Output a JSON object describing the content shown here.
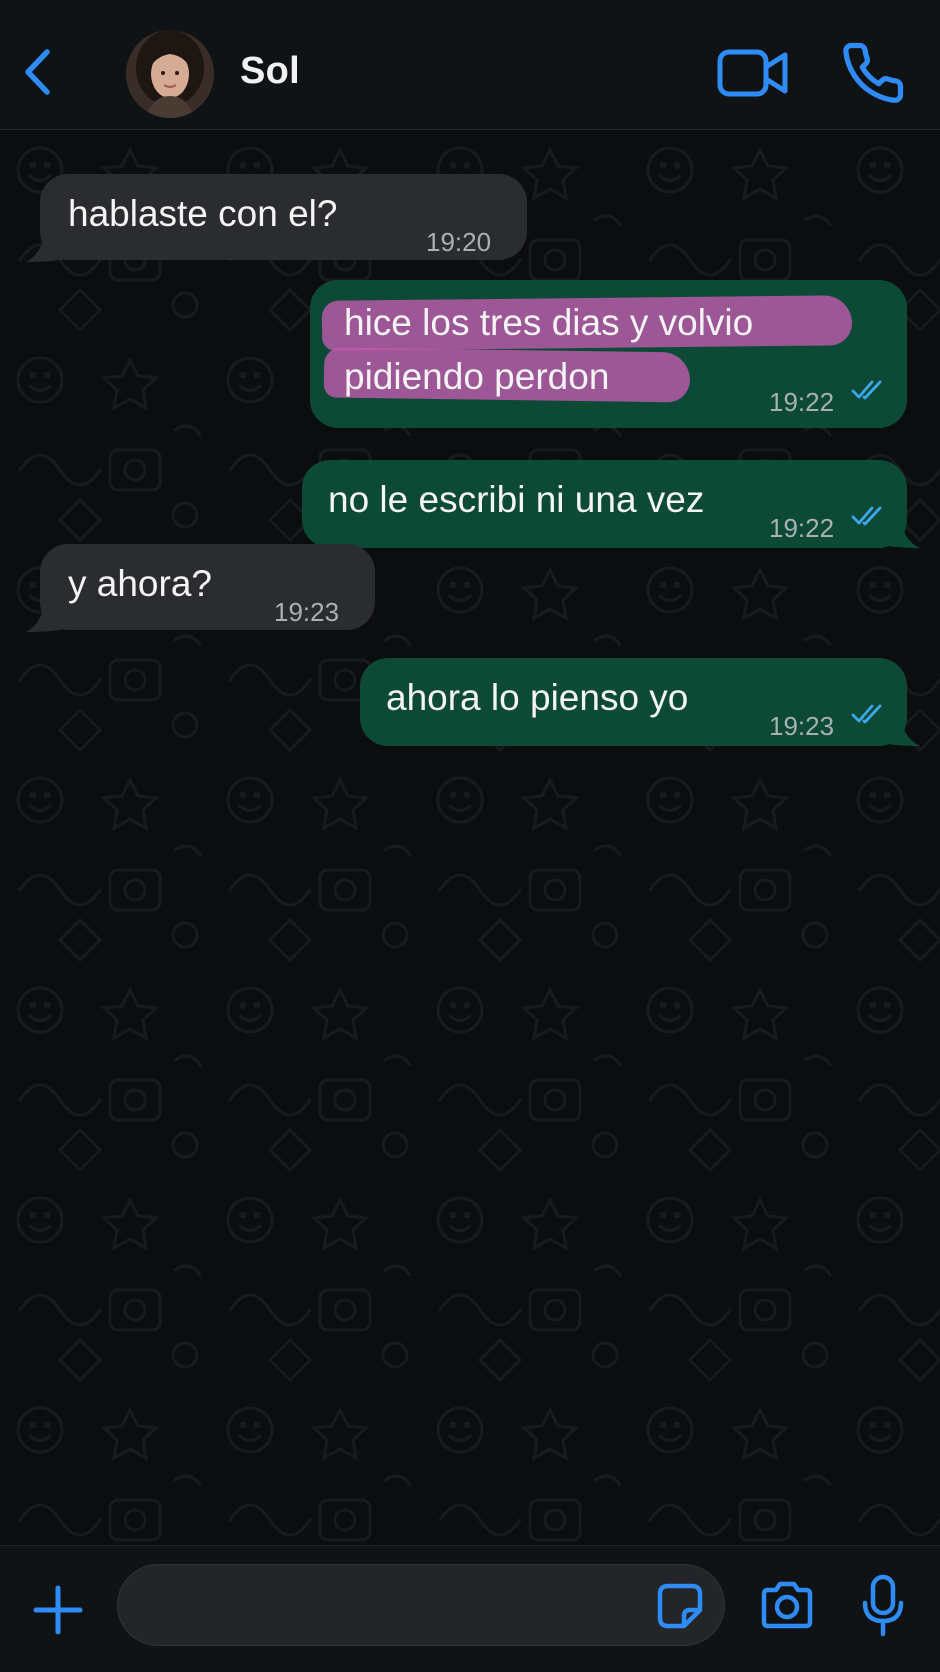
{
  "header": {
    "contact_name": "Sol",
    "accent_color": "#2f8cf5"
  },
  "messages": [
    {
      "direction": "incoming",
      "text": "hablaste con el?",
      "time": "19:20"
    },
    {
      "direction": "outgoing",
      "text_lines": [
        "hice los tres dias y volvio",
        "pidiendo perdon"
      ],
      "time": "19:22",
      "status": "read",
      "highlight_color": "#c65ab1"
    },
    {
      "direction": "outgoing",
      "text": "no le escribi ni una vez",
      "time": "19:22",
      "status": "read"
    },
    {
      "direction": "incoming",
      "text": "y ahora?",
      "time": "19:23"
    },
    {
      "direction": "outgoing",
      "text": "ahora lo pienso yo",
      "time": "19:23",
      "status": "read"
    }
  ],
  "icons": {
    "back": "chevron-left-icon",
    "video": "video-camera-icon",
    "call": "phone-icon",
    "attach": "plus-icon",
    "sticker": "sticker-icon",
    "camera": "camera-icon",
    "mic": "microphone-icon"
  },
  "colors": {
    "incoming_bubble": "#2b2c2f",
    "outgoing_bubble": "#0c4a36",
    "read_ticks": "#3ea7f0"
  },
  "composer": {
    "value": "",
    "placeholder": ""
  }
}
